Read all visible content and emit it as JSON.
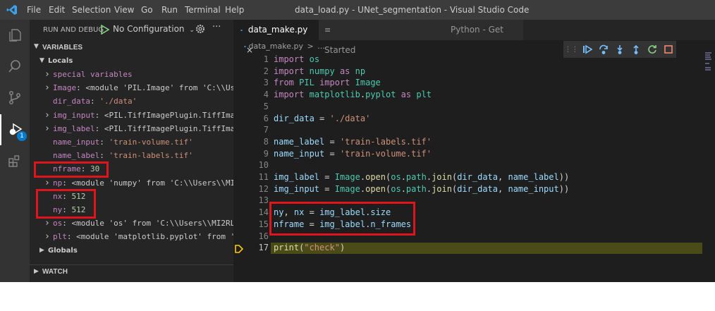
{
  "titlebar": {
    "menus": [
      "File",
      "Edit",
      "Selection",
      "View",
      "Go",
      "Run",
      "Terminal",
      "Help"
    ],
    "title": "data_load.py - UNet_segmentation - Visual Studio Code"
  },
  "activity": {
    "badge": "1"
  },
  "sidebar": {
    "header": "RUN AND DEBUG",
    "config": "No Configuration",
    "variables_title": "VARIABLES",
    "locals_title": "Locals",
    "globals_title": "Globals",
    "watch_title": "WATCH",
    "locals": [
      {
        "name": "special variables",
        "value": "",
        "expandable": true,
        "kind": "group"
      },
      {
        "name": "Image",
        "value": "<module 'PIL.Image' from 'C:\\\\Us...",
        "expandable": true,
        "kind": "obj"
      },
      {
        "name": "dir_data",
        "value": "'./data'",
        "expandable": false,
        "kind": "str"
      },
      {
        "name": "img_input",
        "value": "<PIL.TiffImagePlugin.TiffIma...",
        "expandable": true,
        "kind": "obj"
      },
      {
        "name": "img_label",
        "value": "<PIL.TiffImagePlugin.TiffIma...",
        "expandable": true,
        "kind": "obj"
      },
      {
        "name": "name_input",
        "value": "'train-volume.tif'",
        "expandable": false,
        "kind": "str"
      },
      {
        "name": "name_label",
        "value": "'train-labels.tif'",
        "expandable": false,
        "kind": "str"
      },
      {
        "name": "nframe",
        "value": "30",
        "expandable": false,
        "kind": "num"
      },
      {
        "name": "np",
        "value": "<module 'numpy' from 'C:\\\\Users\\\\MI...",
        "expandable": true,
        "kind": "obj"
      },
      {
        "name": "nx",
        "value": "512",
        "expandable": false,
        "kind": "num"
      },
      {
        "name": "ny",
        "value": "512",
        "expandable": false,
        "kind": "num"
      },
      {
        "name": "os",
        "value": "<module 'os' from 'C:\\\\Users\\\\MI2RL...",
        "expandable": true,
        "kind": "obj"
      },
      {
        "name": "plt",
        "value": "<module 'matplotlib.pyplot' from '...",
        "expandable": true,
        "kind": "obj"
      }
    ]
  },
  "editor": {
    "active_tab": "data_make.py",
    "other_tab": "Python - Get Started",
    "breadcrumb_file": "data_make.py",
    "breadcrumb_sep": ">",
    "breadcrumb_rest": "...",
    "lines": [
      {
        "n": "1",
        "code": "import os"
      },
      {
        "n": "2",
        "code": "import numpy as np"
      },
      {
        "n": "3",
        "code": "from PIL import Image"
      },
      {
        "n": "4",
        "code": "import matplotlib.pyplot as plt"
      },
      {
        "n": "5",
        "code": ""
      },
      {
        "n": "6",
        "code": "dir_data = './data'"
      },
      {
        "n": "7",
        "code": ""
      },
      {
        "n": "8",
        "code": "name_label = 'train-labels.tif'"
      },
      {
        "n": "9",
        "code": "name_input = 'train-volume.tif'"
      },
      {
        "n": "10",
        "code": ""
      },
      {
        "n": "11",
        "code": "img_label = Image.open(os.path.join(dir_data, name_label))"
      },
      {
        "n": "12",
        "code": "img_input = Image.open(os.path.join(dir_data, name_input))"
      },
      {
        "n": "13",
        "code": ""
      },
      {
        "n": "14",
        "code": "ny, nx = img_label.size"
      },
      {
        "n": "15",
        "code": "nframe = img_label.n_frames"
      },
      {
        "n": "16",
        "code": ""
      },
      {
        "n": "17",
        "code": "print(\"check\")"
      }
    ],
    "current_line": "17"
  },
  "colors": {
    "accent": "#007acc",
    "highlight": "#e0141b",
    "current_line_bg": "#4b4b18"
  }
}
